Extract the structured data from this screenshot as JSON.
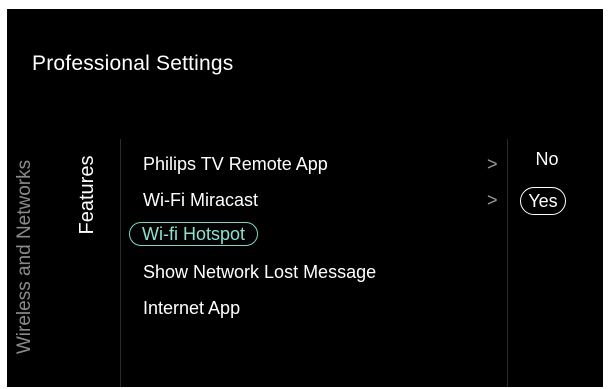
{
  "header": {
    "title": "Professional Settings"
  },
  "nav": {
    "category": "Wireless and Networks",
    "section": "Features"
  },
  "menu": {
    "items": [
      {
        "label": "Philips TV Remote App",
        "has_submenu": true,
        "selected": false
      },
      {
        "label": "Wi-Fi Miracast",
        "has_submenu": true,
        "selected": false
      },
      {
        "label": "Wi-fi Hotspot",
        "has_submenu": false,
        "selected": true
      },
      {
        "label": "Show Network Lost Message",
        "has_submenu": false,
        "selected": false
      },
      {
        "label": "Internet App",
        "has_submenu": false,
        "selected": false
      }
    ],
    "chevron": ">"
  },
  "options": {
    "items": [
      {
        "label": "No",
        "selected": false
      },
      {
        "label": "Yes",
        "selected": true
      }
    ]
  },
  "colors": {
    "background": "#000000",
    "text": "#ffffff",
    "muted": "#8a8a8a",
    "accent": "#7fd6c8"
  },
  "icons": {
    "submenu": "chevron-right-icon"
  }
}
